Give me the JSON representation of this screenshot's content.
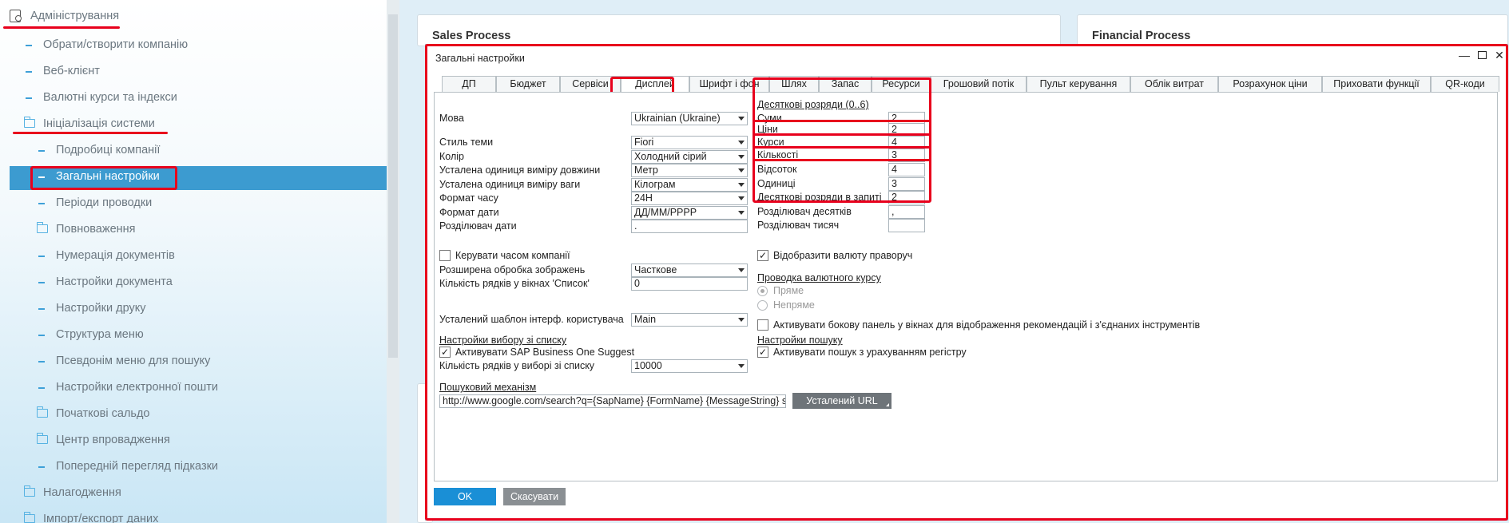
{
  "sidebar": {
    "root": "Адміністрування",
    "items": [
      "Обрати/створити компанію",
      "Веб-клієнт",
      "Валютні курси та індекси",
      "Ініціалізація системи",
      "Подробиці компанії",
      "Загальні настройки",
      "Періоди проводки",
      "Повноваження",
      "Нумерація документів",
      "Настройки документа",
      "Настройки друку",
      "Структура меню",
      "Псевдонім меню для пошуку",
      "Настройки електронної пошти",
      "Початкові сальдо",
      "Центр впровадження",
      "Попередній перегляд підказки",
      "Налагодження",
      "Імпорт/експорт даних"
    ]
  },
  "panels": {
    "left_title": "Sales Process",
    "right_title": "Financial Process"
  },
  "dialog": {
    "title": "Загальні настройки",
    "tabs": [
      "ДП",
      "Бюджет",
      "Сервіси",
      "Дисплей",
      "Шрифт і фон",
      "Шлях",
      "Запас",
      "Ресурси",
      "Грошовий потік",
      "Пульт керування",
      "Облік витрат",
      "Розрахунок ціни",
      "Приховати функції",
      "QR-коди"
    ],
    "left": {
      "language_label": "Мова",
      "language_value": "Ukrainian (Ukraine)",
      "theme_label": "Стиль теми",
      "theme_value": "Fiori",
      "color_label": "Колір",
      "color_value": "Холодний сірий",
      "length_unit_label": "Усталена одиниця виміру довжини",
      "length_unit_value": "Метр",
      "weight_unit_label": "Усталена одиниця виміру ваги",
      "weight_unit_value": "Кілограм",
      "time_format_label": "Формат часу",
      "time_format_value": "24H",
      "date_format_label": "Формат дати",
      "date_format_value": "ДД/ММ/РРРР",
      "date_sep_label": "Розділювач дати",
      "date_sep_value": ".",
      "manage_time_label": "Керувати часом компанії",
      "image_proc_label": "Розширена обробка зображень",
      "image_proc_value": "Часткове",
      "list_rows_label": "Кількість рядків у вікнах 'Список'",
      "list_rows_value": "0",
      "ui_template_label": "Усталений шаблон інтерф. користувача",
      "ui_template_value": "Main",
      "choose_settings_label": "Настройки вибору зі списку",
      "suggest_label": "Активувати SAP Business One Suggest",
      "choose_rows_label": "Кількість рядків у виборі зі списку",
      "choose_rows_value": "10000",
      "search_engine_label": "Пошуковий механізм",
      "search_url": "http://www.google.com/search?q={SapName} {FormName} {MessageString} site:sap.com",
      "default_url_button": "Усталений URL"
    },
    "right": {
      "decimals_header": "Десяткові розряди  (0..6)",
      "amounts_label": "Суми",
      "amounts_value": "2",
      "prices_label": "Ціни",
      "prices_value": "2",
      "rates_label": "Курси",
      "rates_value": "4",
      "quantities_label": "Кількості",
      "quantities_value": "3",
      "percent_label": "Відсоток",
      "percent_value": "4",
      "units_label": "Одиниці",
      "units_value": "3",
      "query_label": "Десяткові розряди в запиті",
      "query_value": "2",
      "dec_sep_label": "Розділювач десятків",
      "dec_sep_value": ",",
      "thousand_sep_label": "Розділювач тисяч",
      "thousand_sep_value": "",
      "currency_right_label": "Відобразити валюту праворуч",
      "rate_posting_label": "Проводка валютного курсу",
      "direct_label": "Пряме",
      "indirect_label": "Непряме",
      "sidebar_label": "Активувати бокову панель у вікнах для відображення рекомендацій і з'єднаних інструментів",
      "search_settings_label": "Настройки пошуку",
      "case_search_label": "Активувати пошук з урахуванням регістру"
    },
    "ok_button": "OK",
    "cancel_button": "Скасувати"
  },
  "colors": {
    "accent_blue": "#3c9bd0",
    "ok_blue": "#1a8fd6",
    "cancel_grey": "#8a8f93",
    "annotation_red": "#e8001c"
  }
}
